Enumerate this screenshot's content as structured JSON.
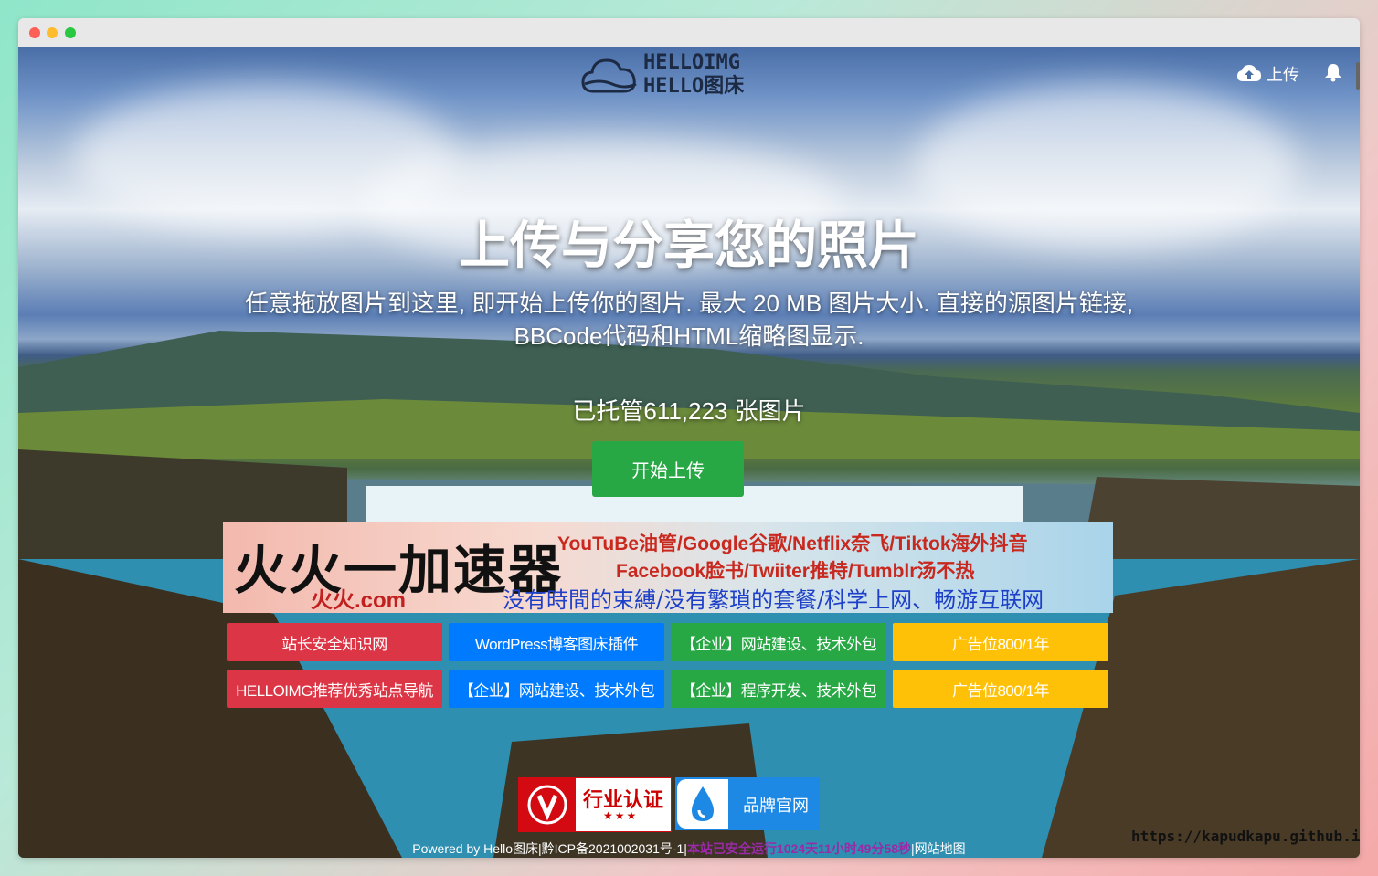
{
  "window": {
    "traffic_lights": {
      "red": "#fe5f57",
      "yellow": "#febc2e",
      "green": "#28c840"
    }
  },
  "header": {
    "logo": {
      "line1": "HELLOIMG",
      "line2": "HELLO图床",
      "icon": "cloud-logo-icon"
    },
    "upload_label": "上传",
    "upload_icon": "cloud-upload-icon",
    "bell_icon": "bell-icon"
  },
  "hero": {
    "title": "上传与分享您的照片",
    "description": "任意拖放图片到这里, 即开始上传你的图片. 最大 20 MB 图片大小. 直接的源图片链接, BBCode代码和HTML缩略图显示.",
    "count": "已托管611,223 张图片",
    "start_button": "开始上传"
  },
  "banner": {
    "title": "火火一加速器",
    "domain": "火火.com",
    "line1": "YouTuBe油管/Google谷歌/Netflix奈飞/Tiktok海外抖音",
    "line2": "Facebook脸书/Twiiter推特/Tumblr汤不热",
    "line3": "没有時間的束縛/没有繁瑣的套餐/科学上网、畅游互联网"
  },
  "links": [
    {
      "label": "站长安全知识网",
      "color": "#dc3545"
    },
    {
      "label": "WordPress博客图床插件",
      "color": "#007bff"
    },
    {
      "label": "【企业】网站建设、技术外包",
      "color": "#28a745"
    },
    {
      "label": "广告位800/1年",
      "color": "#ffc107"
    },
    {
      "label": "HELLOIMG推荐优秀站点导航",
      "color": "#dc3545"
    },
    {
      "label": "【企业】网站建设、技术外包",
      "color": "#007bff"
    },
    {
      "label": "【企业】程序开发、技术外包",
      "color": "#28a745"
    },
    {
      "label": "广告位800/1年",
      "color": "#ffc107"
    }
  ],
  "badges": {
    "verify_label": "行业认证",
    "verify_stars": "★★★",
    "official_label": "品牌官网"
  },
  "footer": {
    "powered": "Powered by Hello图床|黔ICP备2021002031号-1|",
    "runtime": "本站已安全运行1024天11小时49分58秒",
    "sitemap": "|网站地图"
  },
  "watermark": "https://kapudkapu.github.io"
}
